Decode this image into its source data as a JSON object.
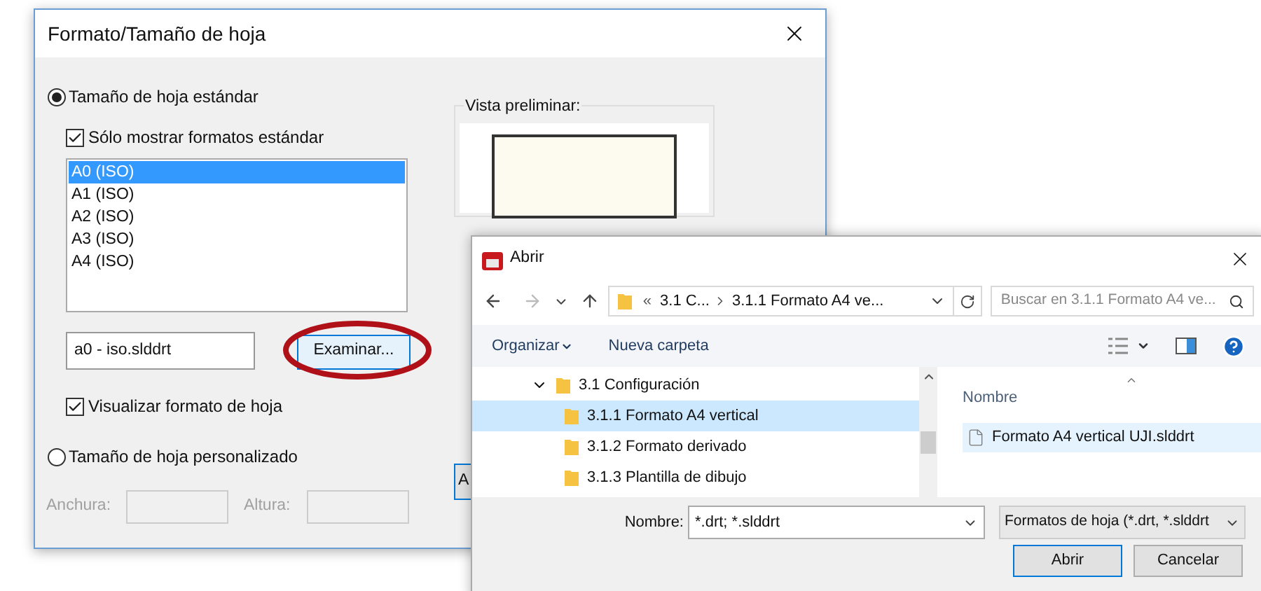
{
  "back_dialog": {
    "title": "Formato/Tamaño de hoja",
    "options": [
      {
        "label": "Tamaño de hoja estándar",
        "selected": true
      },
      {
        "label": "Tamaño de hoja personalizado",
        "selected": false
      }
    ],
    "standard_only": {
      "label": "Sólo mostrar formatos estándar",
      "checked": true
    },
    "sizes": [
      {
        "label": "A0 (ISO)",
        "selected": true
      },
      {
        "label": "A1 (ISO)",
        "selected": false
      },
      {
        "label": "A2 (ISO)",
        "selected": false
      },
      {
        "label": "A3 (ISO)",
        "selected": false
      },
      {
        "label": "A4 (ISO)",
        "selected": false
      }
    ],
    "file_field": {
      "value": "a0 - iso.slddrt"
    },
    "browse_button": "Examinar...",
    "show_format": {
      "label": "Visualizar formato de hoja",
      "checked": true
    },
    "custom_size": {
      "disabled": true,
      "width_label": "Anchura:",
      "height_label": "Altura:"
    },
    "cut_button": "A",
    "preview_label": "Vista preliminar:"
  },
  "open_dialog": {
    "title": "Abrir",
    "breadcrumb_overflow": "«",
    "breadcrumb": [
      "3.1 C...",
      "3.1.1 Formato A4 ve..."
    ],
    "search": {
      "placeholder": "Buscar en 3.1.1 Formato A4 ve..."
    },
    "toolbar": {
      "organize": "Organizar",
      "new_folder": "Nueva carpeta"
    },
    "tree": [
      {
        "label": "3.1 Configuración",
        "expanded": true,
        "selected": false,
        "children": [
          {
            "label": "3.1.1 Formato A4 vertical",
            "selected": true
          },
          {
            "label": "3.1.2 Formato derivado",
            "selected": false
          },
          {
            "label": "3.1.3 Plantilla de dibujo",
            "selected": false
          }
        ]
      }
    ],
    "column": "Nombre",
    "files": [
      {
        "name": "Formato A4 vertical UJI.slddrt",
        "selected": true
      }
    ],
    "name_label": "Nombre:",
    "name_value": "*.drt; *.slddrt",
    "filter": "Formatos de hoja (*.drt, *.slddrt",
    "buttons": [
      {
        "label": "Abrir",
        "default": true
      },
      {
        "label": "Cancelar",
        "default": false
      }
    ]
  }
}
